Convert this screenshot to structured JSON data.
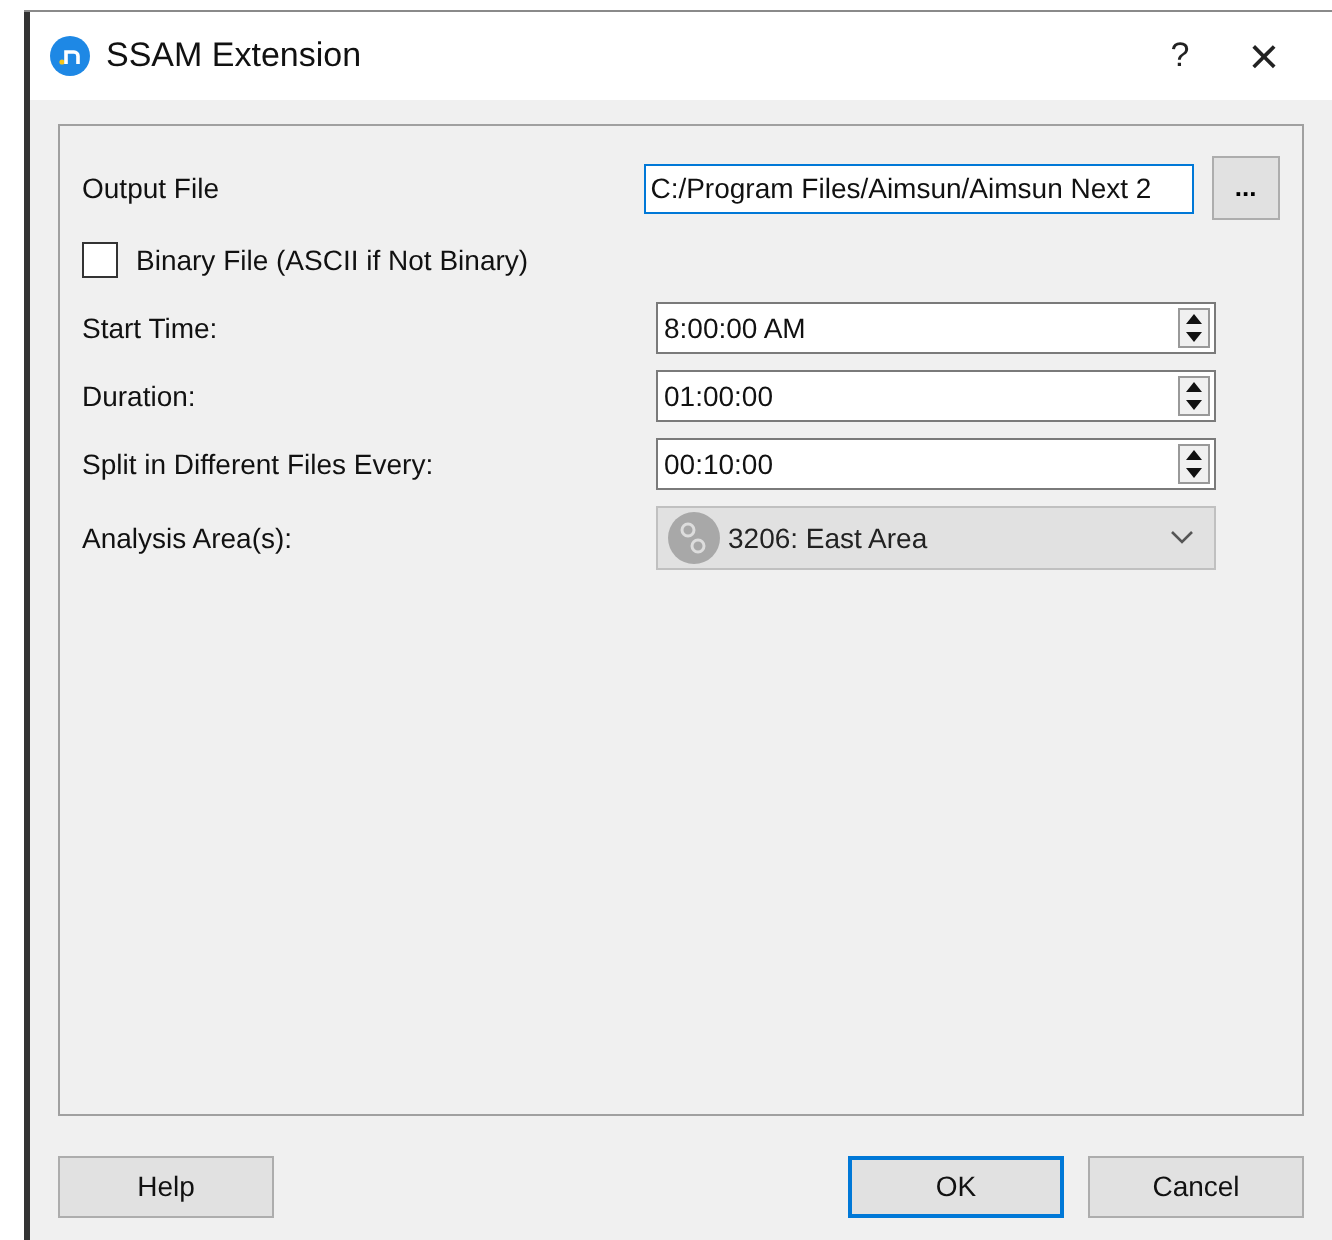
{
  "window": {
    "title": "SSAM Extension",
    "help": "?",
    "close": "×"
  },
  "output_file": {
    "label": "Output File",
    "value": "C:/Program Files/Aimsun/Aimsun Next 2",
    "focused": true,
    "browse": "..."
  },
  "binary_file": {
    "label": "Binary File (ASCII if Not Binary)",
    "checked": false
  },
  "fields": [
    {
      "kind": "spin",
      "label": "Start Time:",
      "value": "8:00:00 AM"
    },
    {
      "kind": "spin",
      "label": "Duration:",
      "value": "01:00:00"
    },
    {
      "kind": "spin",
      "label": "Split in Different Files Every:",
      "value": "00:10:00"
    },
    {
      "kind": "dropdown",
      "label": "Analysis Area(s):",
      "value": "3206: East Area"
    }
  ],
  "buttons": [
    {
      "label": "Help",
      "default": false
    },
    {
      "label": "OK",
      "default": true
    },
    {
      "label": "Cancel",
      "default": false
    }
  ]
}
